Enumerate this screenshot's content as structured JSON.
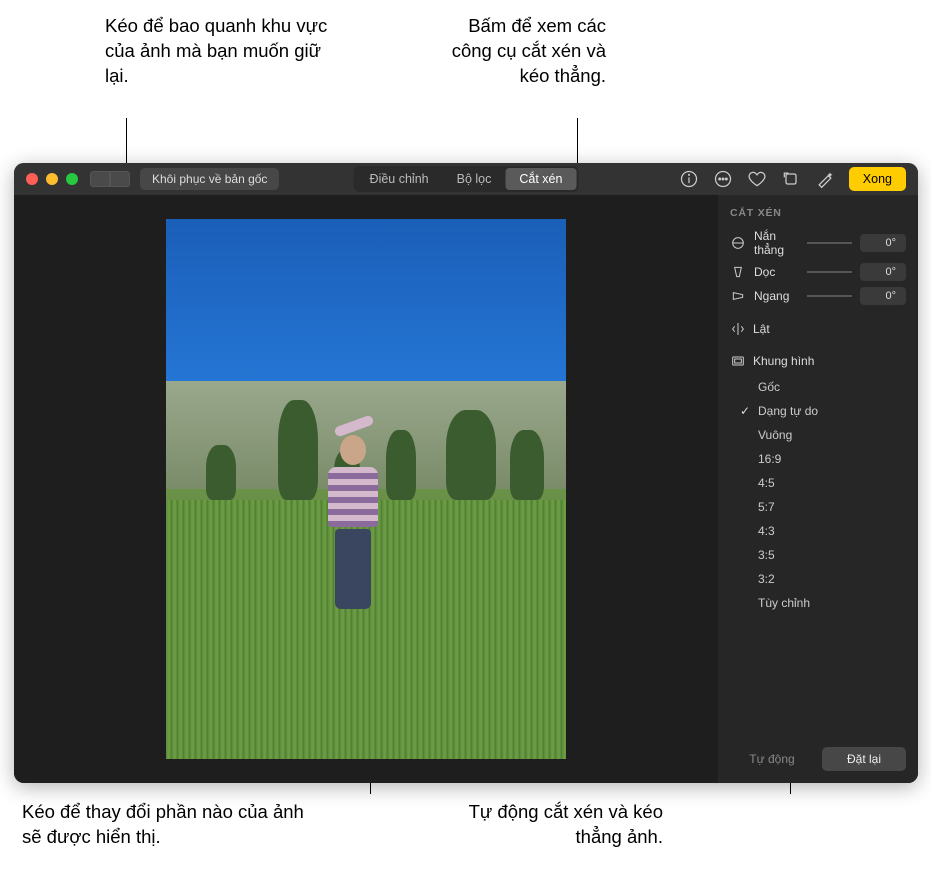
{
  "callouts": {
    "top_left": "Kéo để bao quanh khu vực của ảnh mà bạn muốn giữ lại.",
    "top_right": "Bấm để xem các công cụ cắt xén và kéo thẳng.",
    "bottom_left": "Kéo để thay đổi phần nào của ảnh sẽ được hiển thị.",
    "bottom_right": "Tự động cắt xén và kéo thẳng ảnh."
  },
  "toolbar": {
    "revert": "Khôi phục về bản gốc",
    "segments": {
      "adjust": "Điều chỉnh",
      "filters": "Bộ lọc",
      "crop": "Cắt xén"
    },
    "done": "Xong"
  },
  "sidebar": {
    "title": "CẮT XÉN",
    "straighten": {
      "label": "Nắn thẳng",
      "value": "0°"
    },
    "vertical": {
      "label": "Dọc",
      "value": "0°"
    },
    "horizontal": {
      "label": "Ngang",
      "value": "0°"
    },
    "flip": "Lật",
    "aspect": "Khung hình",
    "aspect_options": [
      "Gốc",
      "Dạng tự do",
      "Vuông",
      "16:9",
      "4:5",
      "5:7",
      "4:3",
      "3:5",
      "3:2",
      "Tùy chỉnh"
    ],
    "aspect_selected_index": 1,
    "footer": {
      "auto": "Tự động",
      "reset": "Đặt lại"
    }
  }
}
